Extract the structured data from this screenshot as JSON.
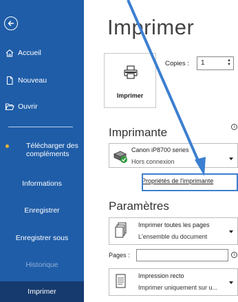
{
  "sidebar": {
    "items": [
      {
        "label": "Accueil"
      },
      {
        "label": "Nouveau"
      },
      {
        "label": "Ouvrir"
      }
    ],
    "addins_label": "Télécharger des compléments",
    "sub_items": [
      {
        "label": "Informations"
      },
      {
        "label": "Enregistrer"
      },
      {
        "label": "Enregistrer sous"
      },
      {
        "label": "Historique"
      },
      {
        "label": "Imprimer"
      }
    ]
  },
  "main": {
    "title": "Imprimer",
    "print_button_label": "Imprimer",
    "copies_label": "Copies :",
    "copies_value": "1",
    "printer_heading": "Imprimante",
    "printer_name": "Canon iP8700 series",
    "printer_status": "Hors connexion",
    "printer_properties_link": "Propriétés de l'imprimante",
    "settings_heading": "Paramètres",
    "settings": [
      {
        "line1": "Imprimer toutes les pages",
        "line2": "L'ensemble du document"
      },
      {
        "line1": "Impression recto",
        "line2": "Imprimer uniquement sur u..."
      }
    ],
    "pages_label": "Pages :",
    "pages_value": ""
  },
  "colors": {
    "sidebar_bg": "#1f5da8",
    "sidebar_active": "#163a6e",
    "annotation_blue": "#3c7fd0",
    "addins_bullet": "#f0b43a"
  }
}
